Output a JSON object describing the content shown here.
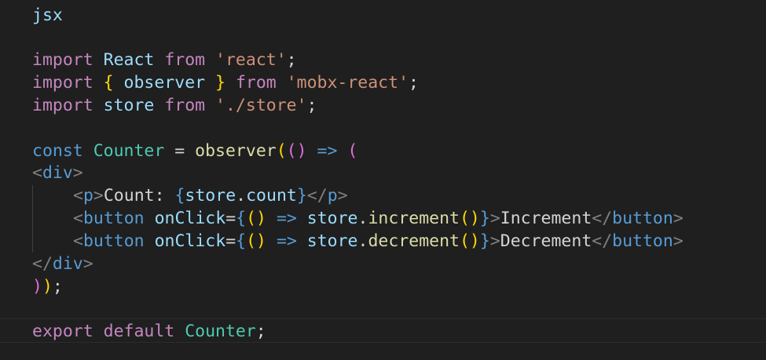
{
  "code": {
    "language_label": "jsx",
    "line3": [
      "import",
      "React",
      "from",
      "'react'",
      ";"
    ],
    "line4": [
      "import",
      "{",
      "observer",
      "}",
      "from",
      "'mobx-react'",
      ";"
    ],
    "line5": [
      "import",
      "store",
      "from",
      "'./store'",
      ";"
    ],
    "line7": [
      "const",
      "Counter",
      "=",
      "observer",
      "(",
      "()",
      "=>",
      "("
    ],
    "line8": [
      "<",
      "div",
      ">"
    ],
    "line9": [
      "<",
      "p",
      ">",
      "Count: ",
      "{",
      "store",
      ".",
      "count",
      "}",
      "</",
      "p",
      ">"
    ],
    "line10": [
      "<",
      "button",
      "onClick",
      "=",
      "{",
      "()",
      "=>",
      "store",
      ".",
      "increment",
      "()",
      "}",
      ">",
      "Increment",
      "</",
      "button",
      ">"
    ],
    "line11": [
      "<",
      "button",
      "onClick",
      "=",
      "{",
      "()",
      "=>",
      "store",
      ".",
      "decrement",
      "()",
      "}",
      ">",
      "Decrement",
      "</",
      "button",
      ">"
    ],
    "line12": [
      "</",
      "div",
      ">"
    ],
    "line13": [
      ")",
      ")",
      ";"
    ],
    "line15": [
      "export",
      "default",
      "Counter",
      ";"
    ]
  },
  "colors": {
    "background": "#1f1f1f",
    "keyword": "#c586c0",
    "storage": "#569cd6",
    "variable": "#9cdcfe",
    "class": "#4ec9b0",
    "string": "#ce9178",
    "function": "#dcdcaa",
    "bracket_gold": "#ffd700",
    "bracket_pink": "#da70d6",
    "bracket_blue": "#179fff"
  }
}
